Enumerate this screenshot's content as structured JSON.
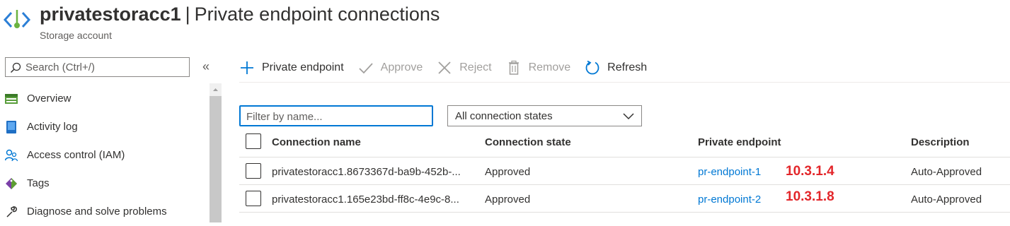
{
  "header": {
    "resource_name": "privatestoracc1",
    "separator": "|",
    "page_title": "Private endpoint connections",
    "subtitle": "Storage account",
    "icon": "private-endpoint-icon"
  },
  "sidebar": {
    "search_placeholder": "Search (Ctrl+/)",
    "collapse_label": "«",
    "items": [
      {
        "label": "Overview",
        "icon": "overview-icon"
      },
      {
        "label": "Activity log",
        "icon": "activity-log-icon"
      },
      {
        "label": "Access control (IAM)",
        "icon": "access-control-icon"
      },
      {
        "label": "Tags",
        "icon": "tag-icon"
      },
      {
        "label": "Diagnose and solve problems",
        "icon": "wrench-icon"
      }
    ]
  },
  "toolbar": {
    "add_label": "Private endpoint",
    "approve_label": "Approve",
    "reject_label": "Reject",
    "remove_label": "Remove",
    "refresh_label": "Refresh"
  },
  "filters": {
    "name_placeholder": "Filter by name...",
    "state_selected": "All connection states"
  },
  "table": {
    "columns": [
      "Connection name",
      "Connection state",
      "Private endpoint",
      "Description"
    ],
    "rows": [
      {
        "connection_name": "privatestoracc1.8673367d-ba9b-452b-...",
        "state": "Approved",
        "endpoint": "pr-endpoint-1",
        "ip_annotation": "10.3.1.4",
        "description": "Auto-Approved"
      },
      {
        "connection_name": "privatestoracc1.165e23bd-ff8c-4e9c-8...",
        "state": "Approved",
        "endpoint": "pr-endpoint-2",
        "ip_annotation": "10.3.1.8",
        "description": "Auto-Approved"
      }
    ]
  },
  "colors": {
    "accent": "#0078d4",
    "annotation": "#e3262a",
    "disabled_text": "#a19f9d"
  }
}
